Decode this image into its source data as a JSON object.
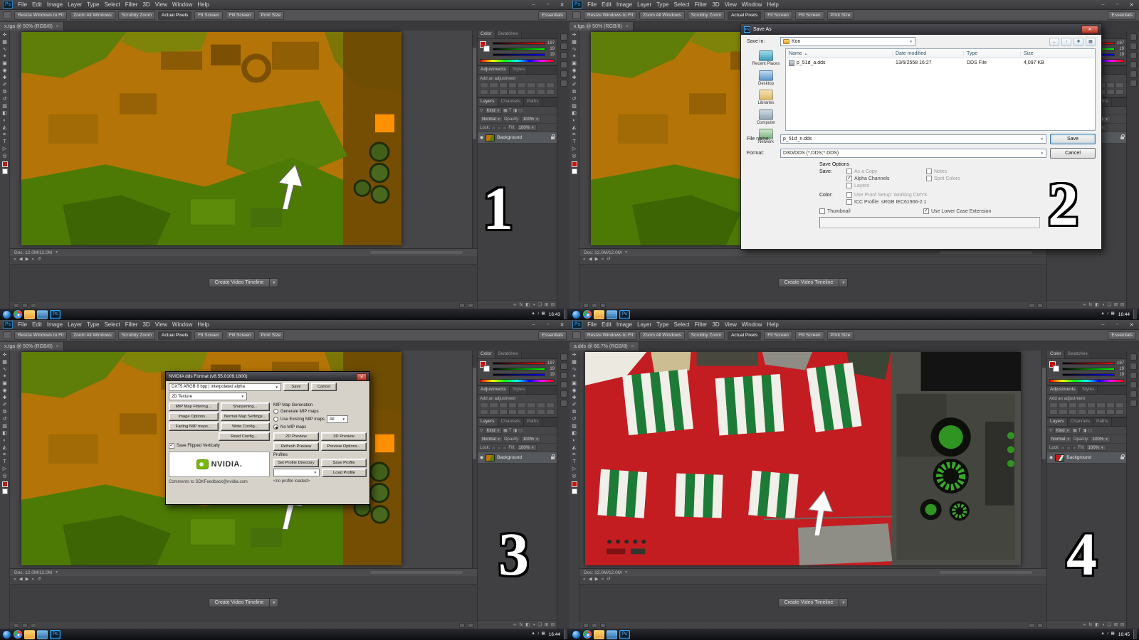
{
  "ui": {
    "caret": "▼",
    "sort": "▲",
    "check": "✓",
    "eye": "◉"
  },
  "colors": {
    "fg_red": "#c51313",
    "ps_blue": "#31a8ff",
    "canvas_orange": "#b47407",
    "canvas_green": "#4d7a05",
    "canvas_red": "#c31d22",
    "stripe_green": "#1c7c37"
  },
  "quadrants": [
    {
      "number": "1",
      "doc_tab": "x.tga @ 50% (RGB/8)",
      "time": "16:43"
    },
    {
      "number": "2",
      "doc_tab": "x.tga @ 50% (RGB/8)",
      "time": "16:44"
    },
    {
      "number": "3",
      "doc_tab": "x.tga @ 50% (RGB/8)",
      "time": "16:44"
    },
    {
      "number": "4",
      "doc_tab": "a.dds @ 66.7% (RGB/8)",
      "time": "16:45"
    }
  ],
  "taskbar": {
    "tray": [
      {
        "name": "tray-expand-icon",
        "glyph": "▲"
      },
      {
        "name": "volume-icon",
        "glyph": "♪"
      },
      {
        "name": "network-icon",
        "glyph": "▦"
      }
    ]
  },
  "ps": {
    "logo": "Ps",
    "menu": [
      "File",
      "Edit",
      "Image",
      "Layer",
      "Type",
      "Select",
      "Filter",
      "3D",
      "View",
      "Window",
      "Help"
    ],
    "options": [
      "Resize Windows to Fit",
      "Zoom All Windows",
      "Scrubby Zoom",
      "Actual Pixels",
      "Fit Screen",
      "Fill Screen",
      "Print Size"
    ],
    "workspace": "Essentials",
    "win": {
      "min": "–",
      "max": "▫",
      "close": "✕"
    },
    "tab_close": "×",
    "tools": [
      {
        "name": "move-tool",
        "glyph": "✛"
      },
      {
        "name": "marquee-tool",
        "glyph": "▦"
      },
      {
        "name": "lasso-tool",
        "glyph": "∿"
      },
      {
        "name": "quick-select-tool",
        "glyph": "✶"
      },
      {
        "name": "crop-tool",
        "glyph": "▣"
      },
      {
        "name": "eyedropper-tool",
        "glyph": "◉"
      },
      {
        "name": "healing-brush-tool",
        "glyph": "✚"
      },
      {
        "name": "brush-tool",
        "glyph": "✐"
      },
      {
        "name": "clone-stamp-tool",
        "glyph": "⧉"
      },
      {
        "name": "history-brush-tool",
        "glyph": "↺"
      },
      {
        "name": "eraser-tool",
        "glyph": "▨"
      },
      {
        "name": "gradient-tool",
        "glyph": "◧"
      },
      {
        "name": "blur-tool",
        "glyph": "◐"
      },
      {
        "name": "dodge-tool",
        "glyph": "◭"
      },
      {
        "name": "pen-tool",
        "glyph": "✒"
      },
      {
        "name": "type-tool",
        "glyph": "T"
      },
      {
        "name": "path-select-tool",
        "glyph": "▷"
      },
      {
        "name": "zoom-tool",
        "glyph": "◎"
      }
    ],
    "kind_icons": [
      "▽",
      "▦",
      "T",
      "◨",
      "▢"
    ],
    "fg_rgb": [
      "197",
      "19",
      "19"
    ],
    "panels": {
      "color": "Color",
      "swatches": "Swatches",
      "adjustments": "Adjustments",
      "styles": "Styles",
      "add_adjustment": "Add an adjustment",
      "layers": "Layers",
      "channels": "Channels",
      "paths": "Paths",
      "kind": "Kind",
      "normal": "Normal",
      "opacity_label": "Opacity:",
      "opacity": "100%",
      "lock_label": "Lock:",
      "fill_label": "Fill:",
      "fill": "100%",
      "background": "Background"
    },
    "layer_footer": [
      {
        "name": "link-layers-icon",
        "glyph": "∞"
      },
      {
        "name": "layer-effects-icon",
        "glyph": "fx"
      },
      {
        "name": "layer-mask-icon",
        "glyph": "◧"
      },
      {
        "name": "adjustment-layer-icon",
        "glyph": "◑"
      },
      {
        "name": "layer-group-icon",
        "glyph": "❏"
      },
      {
        "name": "new-layer-icon",
        "glyph": "⊞"
      },
      {
        "name": "delete-layer-icon",
        "glyph": "⊟"
      }
    ],
    "doc_info": "Doc: 12.0M/12.0M",
    "transport": [
      "«",
      "◀",
      "▶",
      "»",
      "↺"
    ],
    "timeline_btn": "Create Video Timeline"
  },
  "save_dialog": {
    "title": "Save As",
    "close": "✕",
    "appicon": "Ps",
    "save_in_label": "Save in:",
    "save_in_value": "Kon",
    "toolbar_icons": [
      {
        "name": "back-icon",
        "glyph": "←"
      },
      {
        "name": "up-folder-icon",
        "glyph": "↑"
      },
      {
        "name": "new-folder-icon",
        "glyph": "✚"
      },
      {
        "name": "view-menu-icon",
        "glyph": "▦"
      }
    ],
    "columns": [
      "Name",
      "Date modified",
      "Type",
      "Size"
    ],
    "file_row": {
      "name": "p_51d_a.dds",
      "date": "13/6/2558 16:27",
      "type": "DDS File",
      "size": "4,097 KB"
    },
    "places": [
      {
        "label": "Recent Places"
      },
      {
        "label": "Desktop"
      },
      {
        "label": "Libraries"
      },
      {
        "label": "Computer"
      },
      {
        "label": "Network"
      }
    ],
    "file_name_label": "File name:",
    "file_name_value": "p_51d_n.dds",
    "format_label": "Format:",
    "format_value": "D3D/DDS (*.DDS;*.DDS)",
    "save_btn": "Save",
    "cancel_btn": "Cancel",
    "options_title": "Save Options",
    "save_label": "Save:",
    "color_label": "Color:",
    "opt_as_copy": "As a Copy",
    "opt_notes": "Notes",
    "opt_alpha": "Alpha Channels",
    "opt_spot": "Spot Colors",
    "opt_layers": "Layers",
    "opt_proof": "Use Proof Setup:  Working CMYK",
    "opt_icc": "ICC Profile:  sRGB IEC61966-2.1",
    "opt_thumbnail": "Thumbnail",
    "opt_lowercase": "Use Lower Case Extension"
  },
  "nvidia_dialog": {
    "title": "NVIDIA dds Format (v8.55.0109.1800)",
    "close": "✕",
    "format_value": "DXT5    ARGB  8 bpp | interpolated alpha",
    "save_btn": "Save",
    "cancel_btn": "Cancel",
    "texture_type": "2D Texture",
    "buttons": [
      "MIP Map Filtering...",
      "Sharpening...",
      "Image Options...",
      "Normal Map Settings...",
      "Fading MIP maps...",
      "Write Config...",
      "Read Config..."
    ],
    "flip_label": "Save Flipped Vertically",
    "mip_group": "MIP Map Generation",
    "radio_generate": "Generate MIP maps",
    "radio_existing": "Use Existing MIP maps",
    "radio_none": "No MIP maps",
    "all_value": "All",
    "btn_2d": "2D Preview",
    "btn_3d": "3D Preview",
    "btn_refresh": "Refresh Preview",
    "btn_prevopts": "Preview Options...",
    "profiles_label": "Profiles",
    "btn_setdir": "Set Profile Directory",
    "btn_saveprof": "Save Profile",
    "btn_loadprof": "Load Profile",
    "no_profile": "<no profile loaded>",
    "logo_text": "NVIDIA.",
    "comments": "Comments to SDKFeedback@nvidia.com"
  }
}
